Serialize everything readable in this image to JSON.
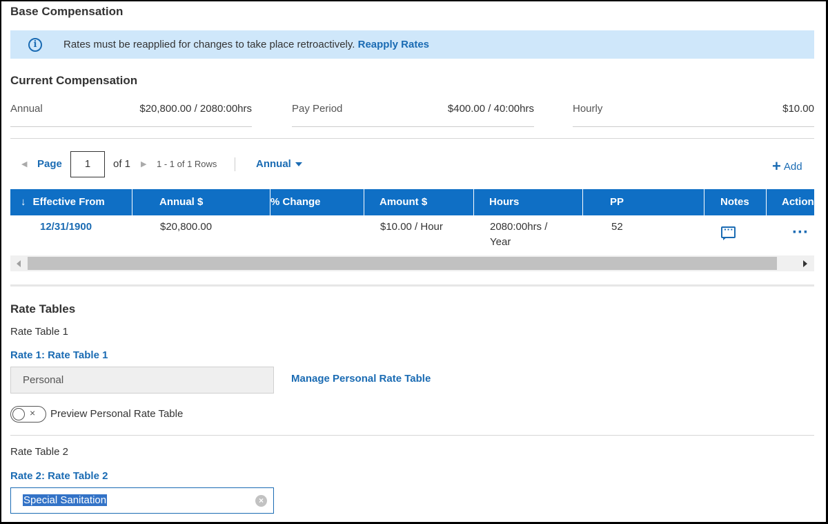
{
  "section": {
    "title": "Base Compensation"
  },
  "banner": {
    "icon": "info-icon",
    "message": "Rates must be reapplied for changes to take place retroactively.",
    "link": "Reapply Rates"
  },
  "current": {
    "title": "Current Compensation",
    "items": [
      {
        "label": "Annual",
        "value": "$20,800.00 / 2080:00hrs"
      },
      {
        "label": "Pay Period",
        "value": "$400.00 / 40:00hrs"
      },
      {
        "label": "Hourly",
        "value": "$10.00"
      }
    ]
  },
  "pager": {
    "page_label": "Page",
    "page_value": "1",
    "of_label": "of 1",
    "rows_info": "1 - 1 of 1 Rows",
    "view_select": "Annual",
    "add_label": "Add"
  },
  "grid": {
    "sort_icon": "arrow-down-icon",
    "columns": [
      "Effective From",
      "Annual $",
      "% Change",
      "Amount $",
      "Hours",
      "PP",
      "Notes",
      "Actions"
    ],
    "rows": [
      {
        "effective_from": "12/31/1900",
        "annual": "$20,800.00",
        "change": "",
        "amount": "$10.00 / Hour",
        "hours_line1": "2080:00hrs /",
        "hours_line2": "Year",
        "pp": "52",
        "notes_icon": "comment-icon",
        "actions_icon": "more-horizontal-icon"
      }
    ]
  },
  "rate_tables": {
    "title": "Rate Tables",
    "table1": {
      "heading": "Rate Table 1",
      "label": "Rate 1: Rate Table 1",
      "value": "Personal",
      "manage_link": "Manage Personal Rate Table",
      "toggle_label": "Preview Personal Rate Table",
      "toggle_state": "off"
    },
    "table2": {
      "heading": "Rate Table 2",
      "label": "Rate 2: Rate Table 2",
      "value": "Special Sanitation"
    }
  },
  "colors": {
    "accent": "#1a6bb3",
    "header_bg": "#0f6fc5",
    "banner_bg": "#cfe7fa"
  }
}
